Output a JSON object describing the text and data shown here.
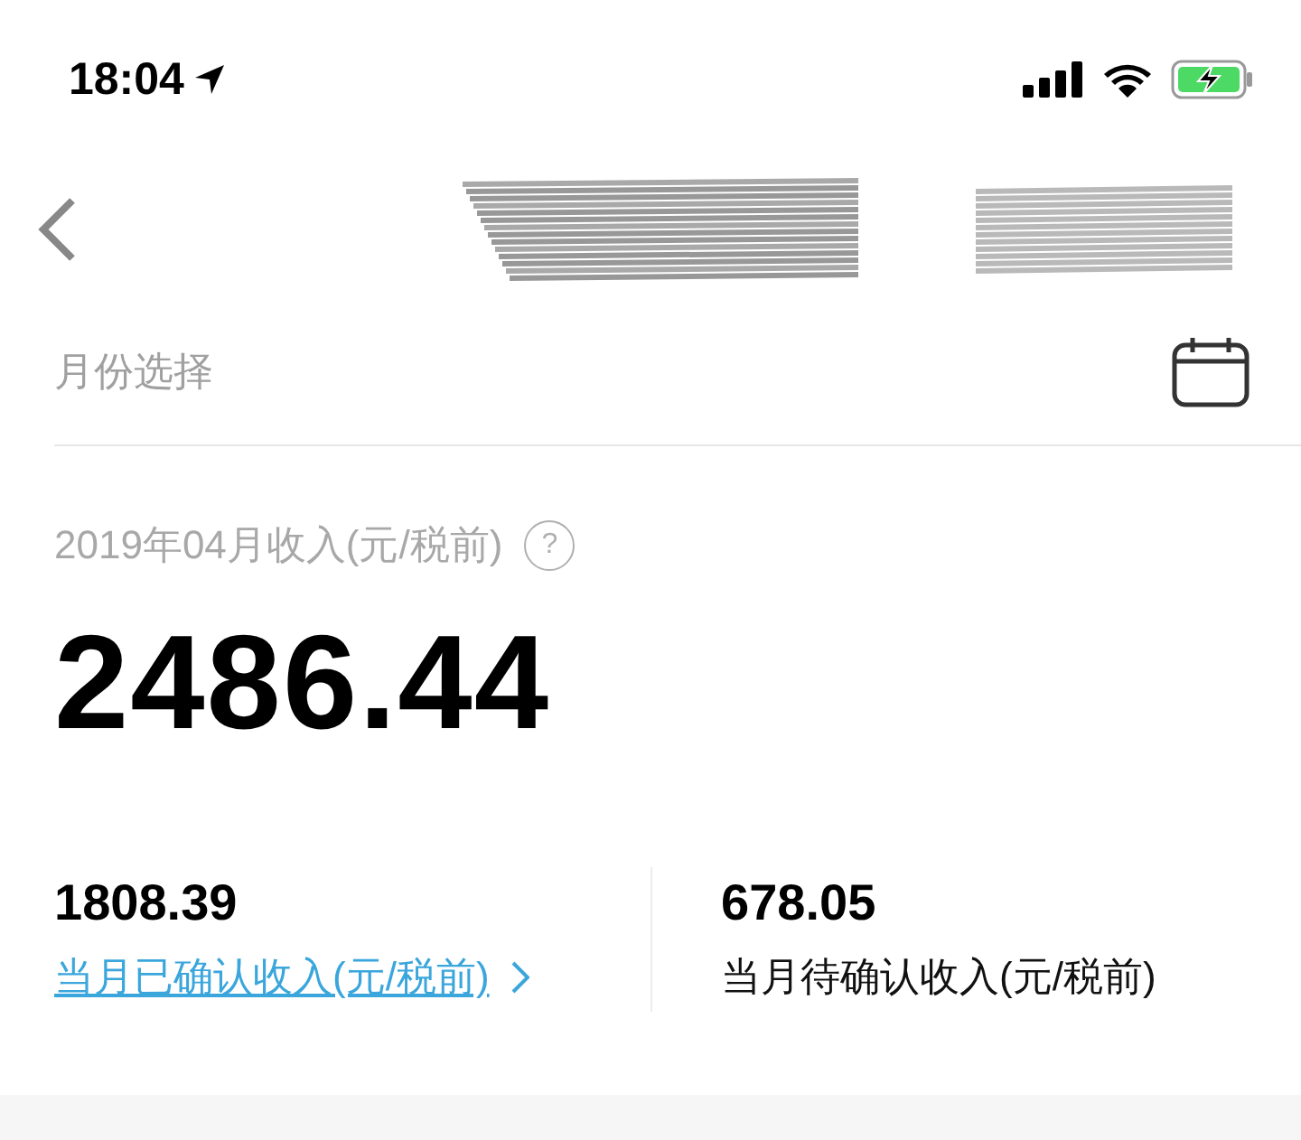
{
  "status_bar": {
    "time": "18:04",
    "location_arrow": true,
    "battery_charging": true
  },
  "nav": {
    "title": {
      "kind": "redacted"
    }
  },
  "month_picker": {
    "label": "月份选择"
  },
  "income": {
    "title": "2019年04月收入(元/税前)",
    "help": "?",
    "amount": "2486.44"
  },
  "stats": [
    {
      "kind": "link",
      "value": "1808.39",
      "label": "当月已确认收入(元/税前)"
    },
    {
      "kind": "plain",
      "value": "678.05",
      "label": "当月待确认收入(元/税前)"
    }
  ]
}
